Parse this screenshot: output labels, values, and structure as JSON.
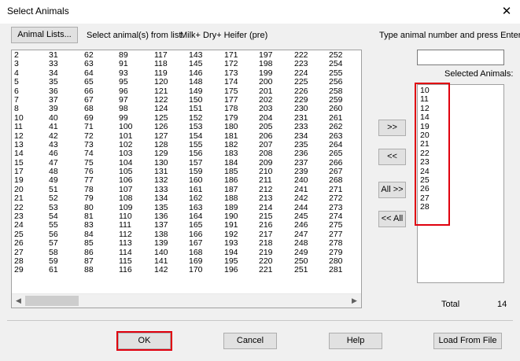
{
  "window": {
    "title": "Select Animals",
    "close_glyph": "✕"
  },
  "top": {
    "animal_lists_button": "Animal Lists...",
    "select_from_label": "Select animal(s) from list:",
    "list_name": "Milk+ Dry+ Heifer (pre)",
    "type_prompt": "Type animal number and press Enter"
  },
  "animals_list": {
    "columns": [
      [
        "2",
        "3",
        "4",
        "5",
        "6",
        "7",
        "8",
        "10",
        "11",
        "12",
        "13",
        "14",
        "15",
        "17",
        "19",
        "20",
        "21",
        "22",
        "23",
        "24",
        "25",
        "26",
        "27",
        "28",
        "29"
      ],
      [
        "31",
        "33",
        "34",
        "35",
        "36",
        "37",
        "39",
        "40",
        "41",
        "42",
        "43",
        "46",
        "47",
        "48",
        "49",
        "51",
        "52",
        "53",
        "54",
        "55",
        "56",
        "57",
        "58",
        "59",
        "61"
      ],
      [
        "62",
        "63",
        "64",
        "65",
        "66",
        "67",
        "68",
        "69",
        "71",
        "72",
        "73",
        "74",
        "75",
        "76",
        "77",
        "78",
        "79",
        "80",
        "81",
        "83",
        "84",
        "85",
        "86",
        "87",
        "88"
      ],
      [
        "89",
        "91",
        "93",
        "95",
        "96",
        "97",
        "98",
        "99",
        "100",
        "101",
        "102",
        "103",
        "104",
        "105",
        "106",
        "107",
        "108",
        "109",
        "110",
        "111",
        "112",
        "113",
        "114",
        "115",
        "116"
      ],
      [
        "117",
        "118",
        "119",
        "120",
        "121",
        "122",
        "124",
        "125",
        "126",
        "127",
        "128",
        "129",
        "130",
        "131",
        "132",
        "133",
        "134",
        "135",
        "136",
        "137",
        "138",
        "139",
        "140",
        "141",
        "142"
      ],
      [
        "143",
        "145",
        "146",
        "148",
        "149",
        "150",
        "151",
        "152",
        "153",
        "154",
        "155",
        "156",
        "157",
        "159",
        "160",
        "161",
        "162",
        "163",
        "164",
        "165",
        "166",
        "167",
        "168",
        "169",
        "170"
      ],
      [
        "171",
        "172",
        "173",
        "174",
        "175",
        "177",
        "178",
        "179",
        "180",
        "181",
        "182",
        "183",
        "184",
        "185",
        "186",
        "187",
        "188",
        "189",
        "190",
        "191",
        "192",
        "193",
        "194",
        "195",
        "196"
      ],
      [
        "197",
        "198",
        "199",
        "200",
        "201",
        "202",
        "203",
        "204",
        "205",
        "206",
        "207",
        "208",
        "209",
        "210",
        "211",
        "212",
        "213",
        "214",
        "215",
        "216",
        "217",
        "218",
        "219",
        "220",
        "221"
      ],
      [
        "222",
        "223",
        "224",
        "225",
        "226",
        "229",
        "230",
        "231",
        "233",
        "234",
        "235",
        "236",
        "237",
        "239",
        "240",
        "241",
        "242",
        "244",
        "245",
        "246",
        "247",
        "248",
        "249",
        "250",
        "251"
      ],
      [
        "252",
        "254",
        "255",
        "256",
        "258",
        "259",
        "260",
        "261",
        "262",
        "263",
        "264",
        "265",
        "266",
        "267",
        "268",
        "271",
        "272",
        "273",
        "274",
        "275",
        "277",
        "278",
        "279",
        "280",
        "281"
      ]
    ]
  },
  "transfer_buttons": {
    "add": ">>",
    "remove": "<<",
    "add_all": "All >>",
    "remove_all": "<< All"
  },
  "selected": {
    "label": "Selected Animals:",
    "items": [
      "10",
      "11",
      "12",
      "14",
      "19",
      "20",
      "21",
      "22",
      "23",
      "24",
      "25",
      "26",
      "27",
      "28"
    ],
    "total_label": "Total",
    "total_value": "14"
  },
  "bottom": {
    "ok": "OK",
    "cancel": "Cancel",
    "help": "Help",
    "load_from_file": "Load From File"
  },
  "highlight_color": "#e0000e"
}
